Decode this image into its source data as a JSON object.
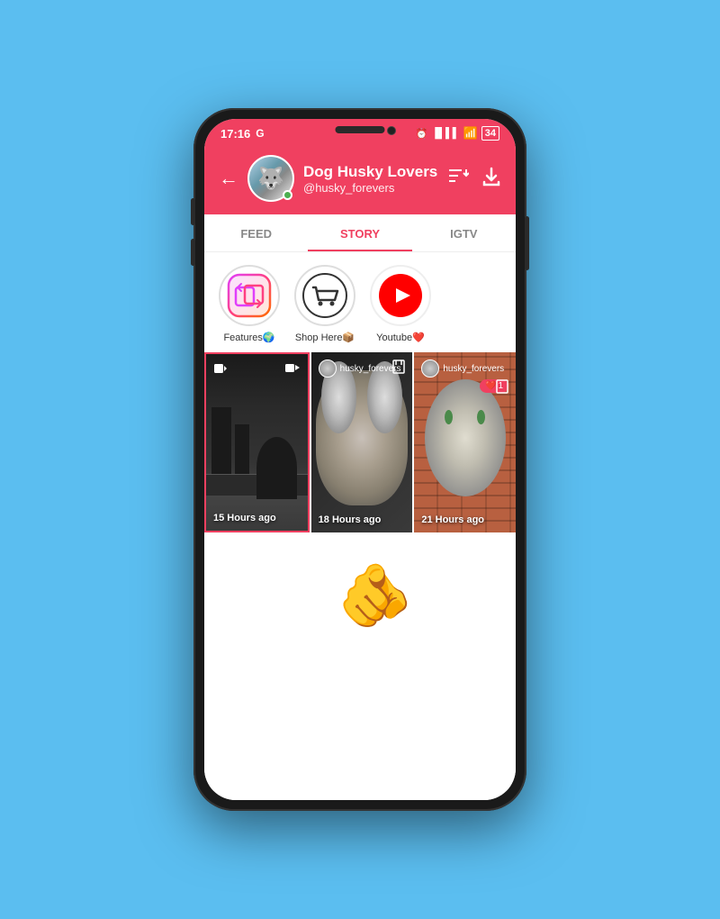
{
  "status_bar": {
    "time": "17:16",
    "carrier_icon": "G",
    "alarm": "⏰",
    "signal": "📶",
    "wifi": "WiFi",
    "battery": "34"
  },
  "header": {
    "back_label": "←",
    "name": "Dog Husky Lovers",
    "username": "@husky_forevers",
    "sort_icon": "sort",
    "download_icon": "download"
  },
  "tabs": [
    {
      "id": "feed",
      "label": "FEED",
      "active": false
    },
    {
      "id": "story",
      "label": "STORY",
      "active": true
    },
    {
      "id": "igtv",
      "label": "IGTV",
      "active": false
    }
  ],
  "highlights": [
    {
      "id": "features",
      "label": "Features🌍",
      "icon": "features"
    },
    {
      "id": "shop",
      "label": "Shop Here📦",
      "icon": "shop"
    },
    {
      "id": "youtube",
      "label": "Youtube❤️",
      "icon": "youtube"
    }
  ],
  "stories": [
    {
      "id": 1,
      "selected": true,
      "time": "15 Hours ago",
      "has_video_icon": true,
      "has_camera_icon": true,
      "username": null
    },
    {
      "id": 2,
      "selected": false,
      "time": "18 Hours ago",
      "username": "husky_forevers",
      "has_video_icon": false,
      "has_camera_icon": false
    },
    {
      "id": 3,
      "selected": false,
      "time": "21 Hours ago",
      "username": "husky_forevers",
      "has_like": true,
      "like_count": "1",
      "has_camera_icon": false
    }
  ]
}
